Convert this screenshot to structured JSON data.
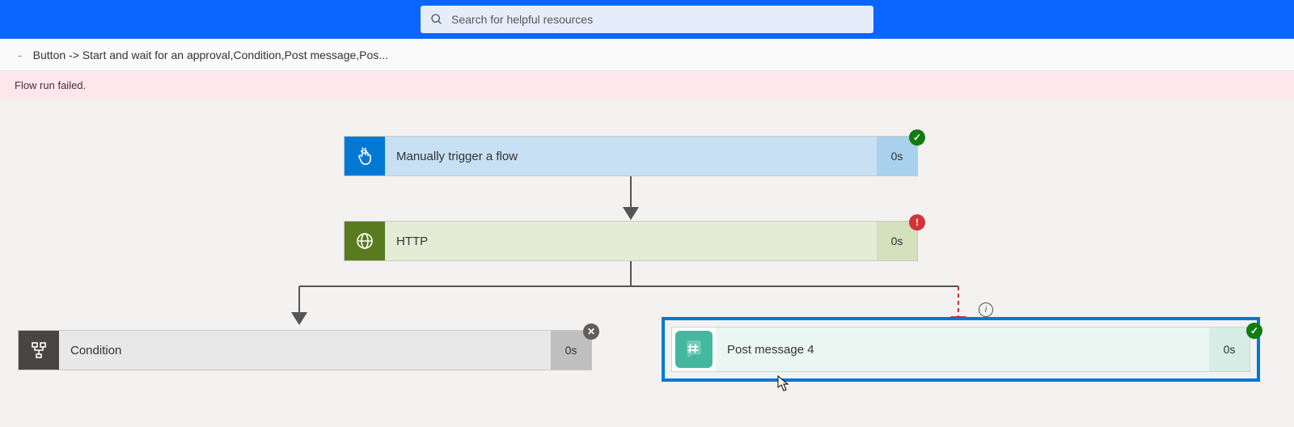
{
  "search": {
    "placeholder": "Search for helpful resources"
  },
  "breadcrumb": {
    "separator": "-",
    "text": "Button -> Start and wait for an approval,Condition,Post message,Pos..."
  },
  "banner": {
    "message": "Flow run failed."
  },
  "steps": {
    "trigger": {
      "label": "Manually trigger a flow",
      "duration": "0s",
      "status": "success",
      "icon": "touch-icon"
    },
    "http": {
      "label": "HTTP",
      "duration": "0s",
      "status": "error",
      "icon": "globe-icon"
    },
    "condition": {
      "label": "Condition",
      "duration": "0s",
      "status": "skipped",
      "icon": "condition-icon"
    },
    "postmsg": {
      "label": "Post message 4",
      "duration": "0s",
      "status": "success",
      "icon": "hash-icon"
    }
  },
  "icons": {
    "check": "✓",
    "exclaim": "!",
    "cross": "✕",
    "info": "i"
  },
  "colors": {
    "topbar": "#0a66ff",
    "error_bg": "#fde7ec",
    "selected_border": "#0078d4"
  }
}
